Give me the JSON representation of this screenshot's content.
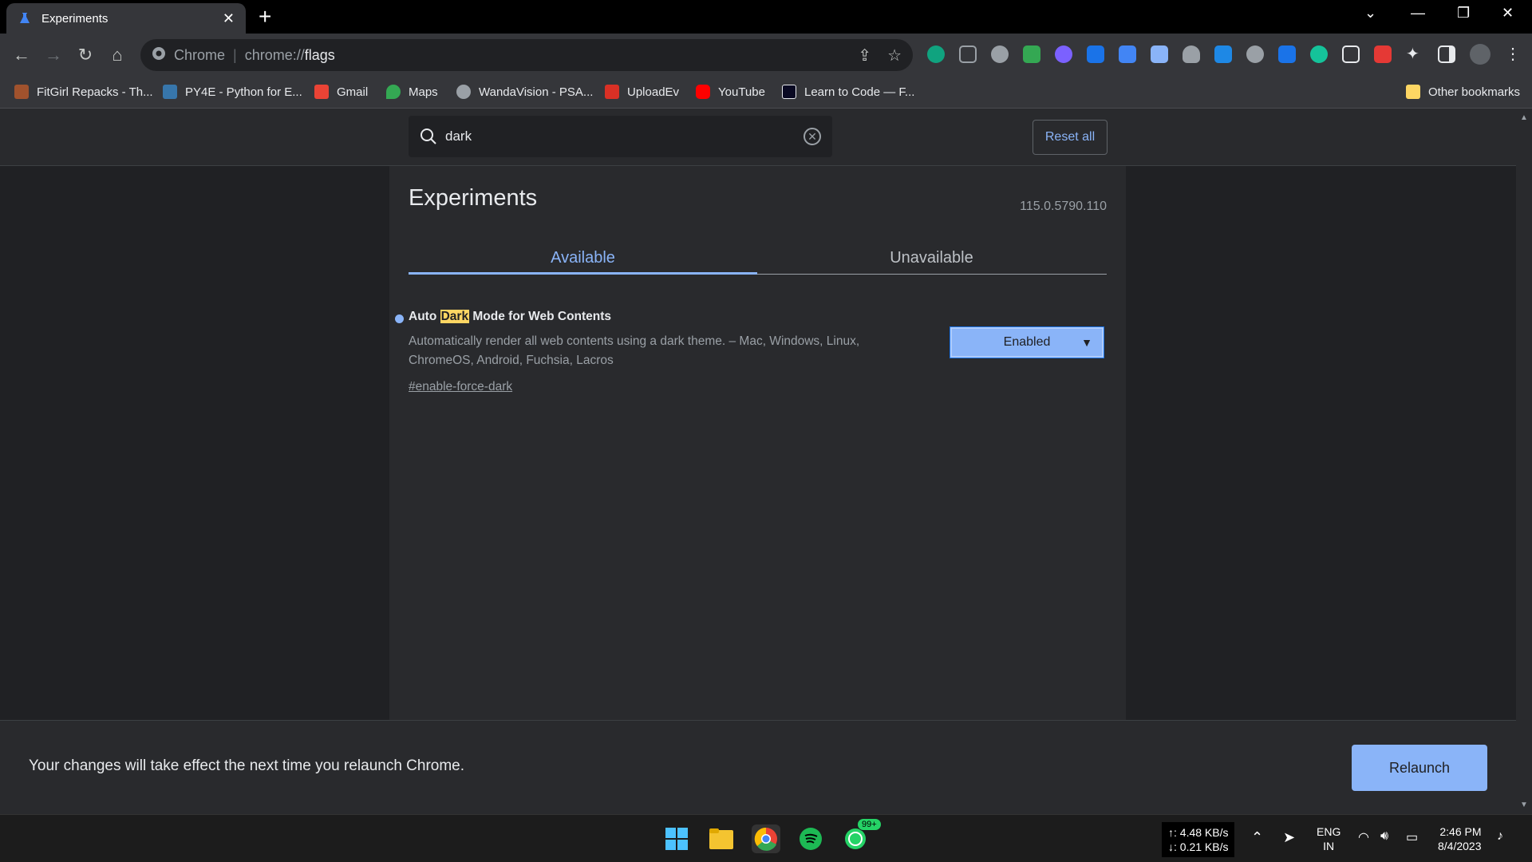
{
  "window": {
    "tab_title": "Experiments",
    "tab_close": "✕",
    "new_tab": "+"
  },
  "toolbar": {
    "site_label": "Chrome",
    "url_scheme": "chrome://",
    "url_path": "flags"
  },
  "bookmarks": [
    {
      "label": "FitGirl Repacks - Th...",
      "color": "#a0522d"
    },
    {
      "label": "PY4E - Python for E...",
      "color": "#3776ab"
    },
    {
      "label": "Gmail",
      "color": "#ea4335"
    },
    {
      "label": "Maps",
      "color": "#34a853"
    },
    {
      "label": "WandaVision - PSA...",
      "color": "#9aa0a6"
    },
    {
      "label": "UploadEv",
      "color": "#d93025"
    },
    {
      "label": "YouTube",
      "color": "#ff0000"
    },
    {
      "label": "Learn to Code — F...",
      "color": "#0a0a23"
    }
  ],
  "other_bookmarks": "Other bookmarks",
  "search": {
    "query": "dark",
    "reset_label": "Reset all"
  },
  "page": {
    "title": "Experiments",
    "version": "115.0.5790.110",
    "tabs": {
      "available": "Available",
      "unavailable": "Unavailable"
    }
  },
  "flag": {
    "title_before": "Auto ",
    "title_highlight": "Dark",
    "title_after": " Mode for Web Contents",
    "description": "Automatically render all web contents using a dark theme. – Mac, Windows, Linux, ChromeOS, Android, Fuchsia, Lacros",
    "link": "#enable-force-dark",
    "selected_option": "Enabled"
  },
  "footer": {
    "message": "Your changes will take effect the next time you relaunch Chrome.",
    "relaunch_label": "Relaunch"
  },
  "taskbar": {
    "whatsapp_badge": "99+",
    "net_up": "↑: 4.48 KB/s",
    "net_down": "↓: 0.21 KB/s",
    "lang_top": "ENG",
    "lang_bottom": "IN",
    "time": "2:46 PM",
    "date": "8/4/2023"
  },
  "colors": {
    "accent": "#8ab4f8",
    "highlight": "#fdd663"
  }
}
